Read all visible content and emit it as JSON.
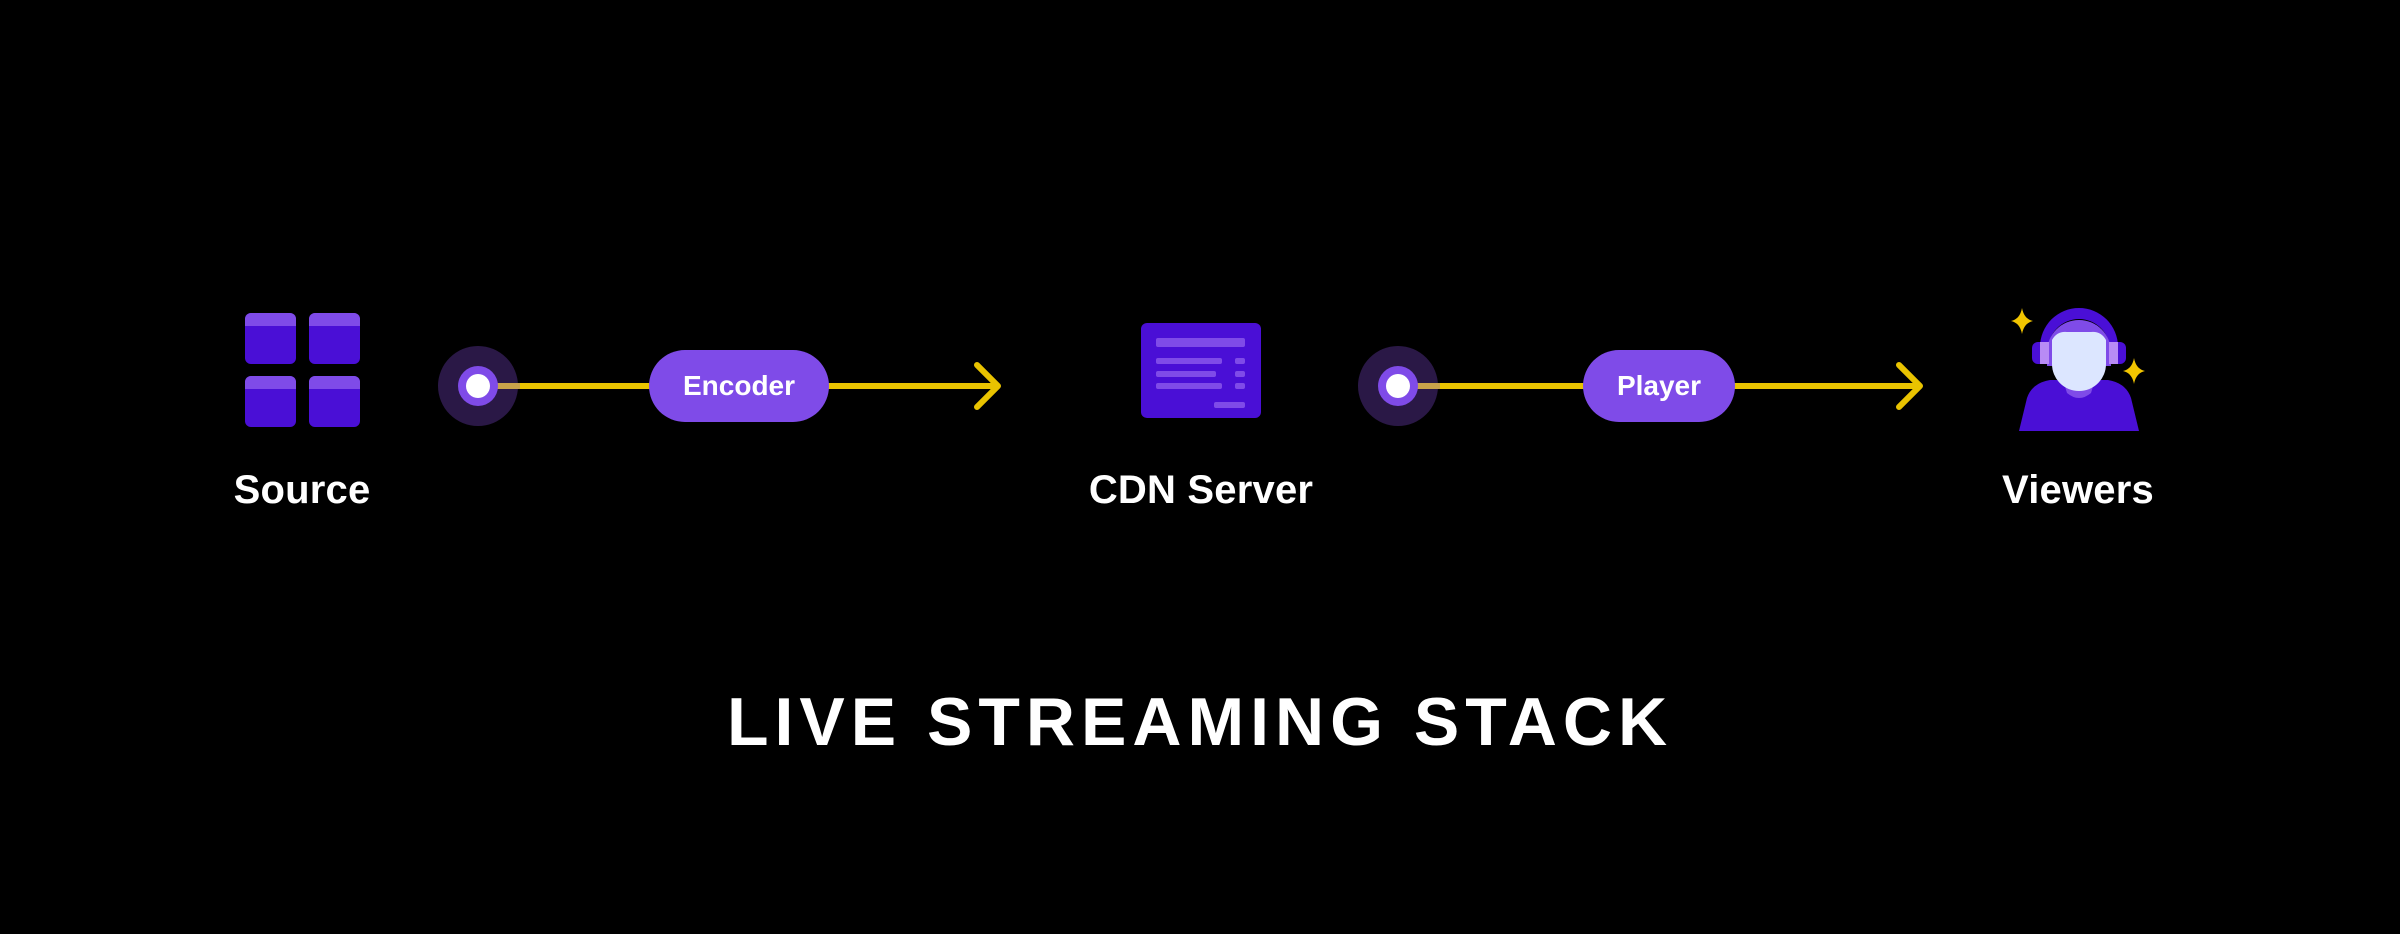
{
  "diagram": {
    "title": "LIVE STREAMING STACK",
    "nodes": [
      {
        "id": "source",
        "label": "Source",
        "icon": "grid-tiles-icon"
      },
      {
        "id": "cdn",
        "label": "CDN Server",
        "icon": "server-icon"
      },
      {
        "id": "viewers",
        "label": "Viewers",
        "icon": "viewer-headphones-icon"
      }
    ],
    "edges": [
      {
        "from": "source",
        "to": "cdn",
        "label": "Encoder"
      },
      {
        "from": "cdn",
        "to": "viewers",
        "label": "Player"
      }
    ],
    "colors": {
      "background": "#000000",
      "primary_purple": "#4A0FD6",
      "light_purple": "#7F4BE8",
      "arrow_yellow": "#E9C300",
      "face": "#DCE6FF",
      "text": "#FFFFFF"
    }
  }
}
